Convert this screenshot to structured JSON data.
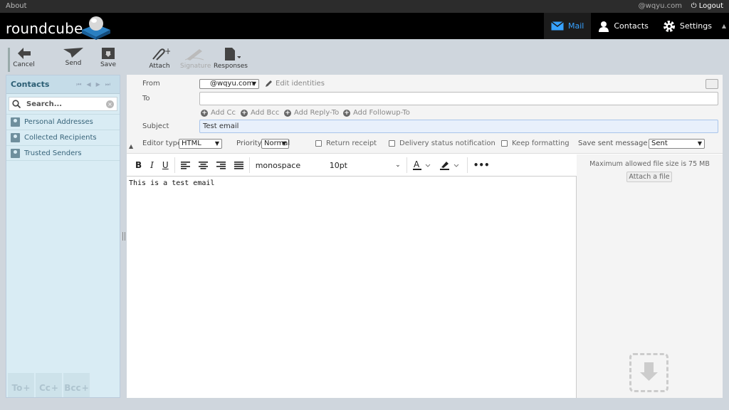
{
  "topline": {
    "about": "About",
    "user": "@wqyu.com",
    "logout": "Logout"
  },
  "header": {
    "logo_text": "roundcube",
    "tasks": [
      {
        "label": "Mail",
        "icon": "mail-icon"
      },
      {
        "label": "Contacts",
        "icon": "person-icon"
      },
      {
        "label": "Settings",
        "icon": "gear-icon"
      }
    ]
  },
  "toolbar": {
    "cancel": "Cancel",
    "send": "Send",
    "save": "Save",
    "attach": "Attach",
    "signature": "Signature",
    "responses": "Responses"
  },
  "contacts": {
    "title": "Contacts",
    "search_placeholder": "Search...",
    "addressbooks": [
      "Personal Addresses",
      "Collected Recipients",
      "Trusted Senders"
    ],
    "footer": [
      "To",
      "Cc",
      "Bcc"
    ]
  },
  "compose": {
    "from_label": "From",
    "from_value": "@wqyu.com",
    "edit_identities": "Edit identities",
    "to_label": "To",
    "to_value": "",
    "add_cc": "Add Cc",
    "add_bcc": "Add Bcc",
    "add_replyto": "Add Reply-To",
    "add_followupto": "Add Followup-To",
    "subject_label": "Subject",
    "subject_value": "Test email",
    "editor_type_label": "Editor type",
    "editor_type_value": "HTML",
    "priority_label": "Priority",
    "priority_value": "Normal",
    "return_receipt": "Return receipt",
    "dsn": "Delivery status notification",
    "keep_formatting": "Keep formatting",
    "save_sent_label": "Save sent message in",
    "save_sent_value": "Sent"
  },
  "editor": {
    "bold": "B",
    "italic": "I",
    "underline": "U",
    "font": "monospace",
    "size": "10pt",
    "more": "•••",
    "body": "This is a test email"
  },
  "attachments": {
    "max_size": "Maximum allowed file size is 75 MB",
    "attach_file": "Attach a file"
  },
  "colors": {
    "accent": "#37a2ff",
    "header_bg": "#000000",
    "contacts_bg": "#d9ecf4"
  }
}
